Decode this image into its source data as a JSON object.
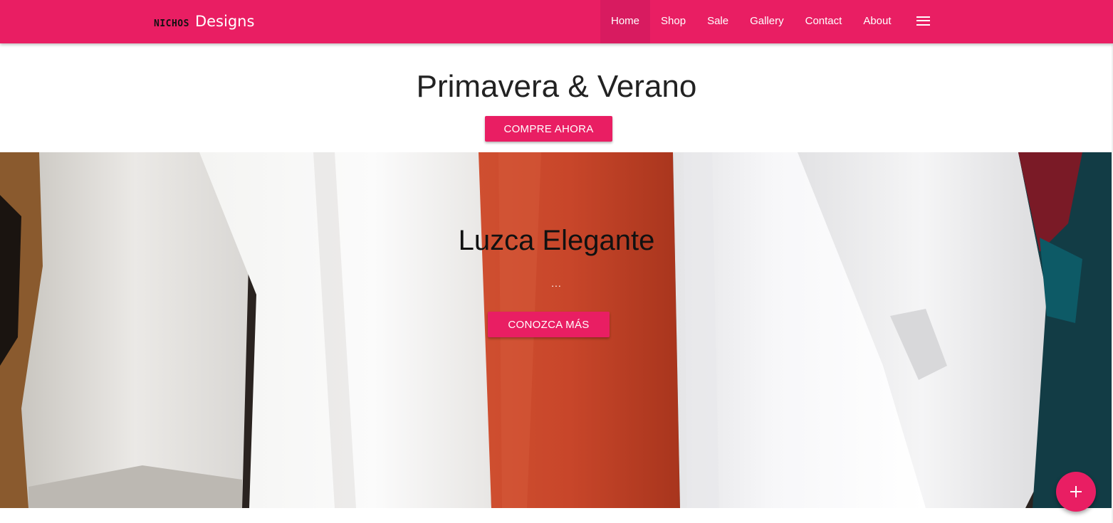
{
  "navbar": {
    "brand_mark": "NICHOS",
    "brand_name": "Designs",
    "links": [
      {
        "label": "Home",
        "active": true
      },
      {
        "label": "Shop"
      },
      {
        "label": "Sale"
      },
      {
        "label": "Gallery"
      },
      {
        "label": "Contact"
      },
      {
        "label": "About"
      }
    ],
    "menu_icon": "hamburger-menu-icon",
    "background": "#e91e63",
    "active_background": "#d81b60"
  },
  "intro": {
    "title": "Primavera & Verano",
    "button_label": "COMPRE AHORA"
  },
  "hero": {
    "title": "Luzca Elegante",
    "subtitle": "...",
    "button_label": "CONOZCA MÁS",
    "image": "white-shirt-with-orange-tie-photo"
  },
  "fab": {
    "icon": "plus-icon"
  },
  "colors": {
    "accent": "#e91e63"
  }
}
